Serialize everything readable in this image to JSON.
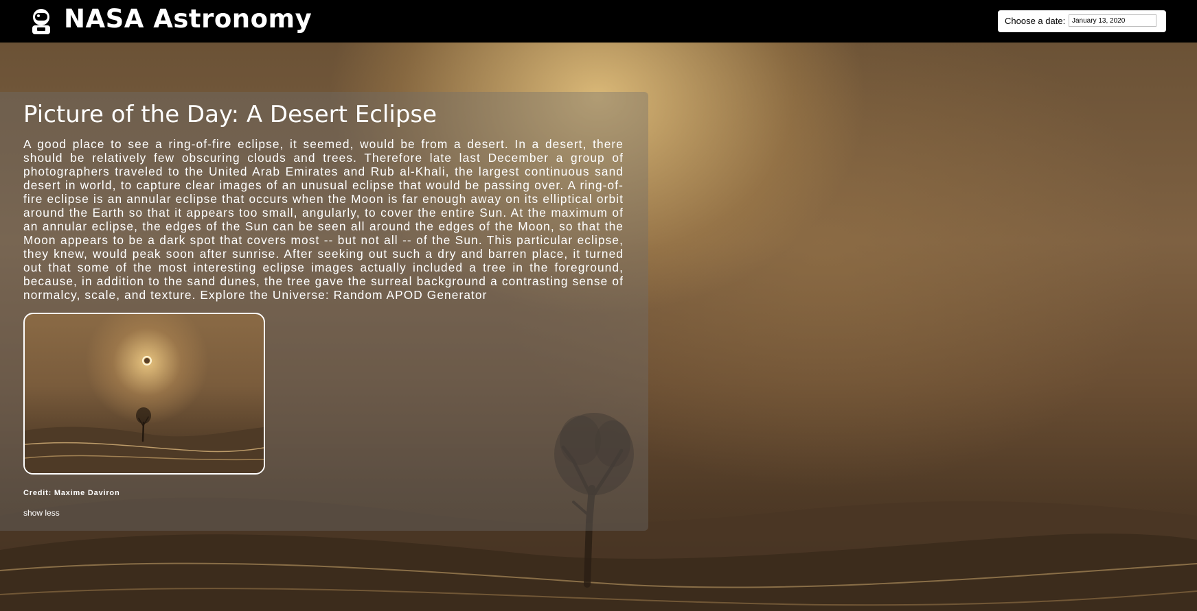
{
  "header": {
    "app_title": "NASA Astronomy",
    "logo_icon": "astronaut-icon",
    "date_label": "Choose a date:",
    "date_value": "January 13, 2020"
  },
  "apod": {
    "title": "Picture of the Day: A Desert Eclipse",
    "explanation": "A good place to see a ring-of-fire eclipse, it seemed, would be from a desert. In a desert, there should be relatively few obscuring clouds and trees. Therefore late last December a group of photographers traveled to the United Arab Emirates and Rub al-Khali, the largest continuous sand desert in world, to capture clear images of an unusual eclipse that would be passing over. A ring-of-fire eclipse is an annular eclipse that occurs when the Moon is far enough away on its elliptical orbit around the Earth so that it appears too small, angularly, to cover the entire Sun. At the maximum of an annular eclipse, the edges of the Sun can be seen all around the edges of the Moon, so that the Moon appears to be a dark spot that covers most -- but not all -- of the Sun. This particular eclipse, they knew, would peak soon after sunrise. After seeking out such a dry and barren place, it turned out that some of the most interesting eclipse images actually included a tree in the foreground, because, in addition to the sand dunes, the tree gave the surreal background a contrasting sense of normalcy, scale, and texture. Explore the Universe: Random APOD Generator",
    "credit": "Credit: Maxime Daviron",
    "toggle_label": "show less"
  },
  "colors": {
    "header_bg": "#000000",
    "card_bg": "rgba(110,110,110,0.38)",
    "text": "#ffffff"
  }
}
